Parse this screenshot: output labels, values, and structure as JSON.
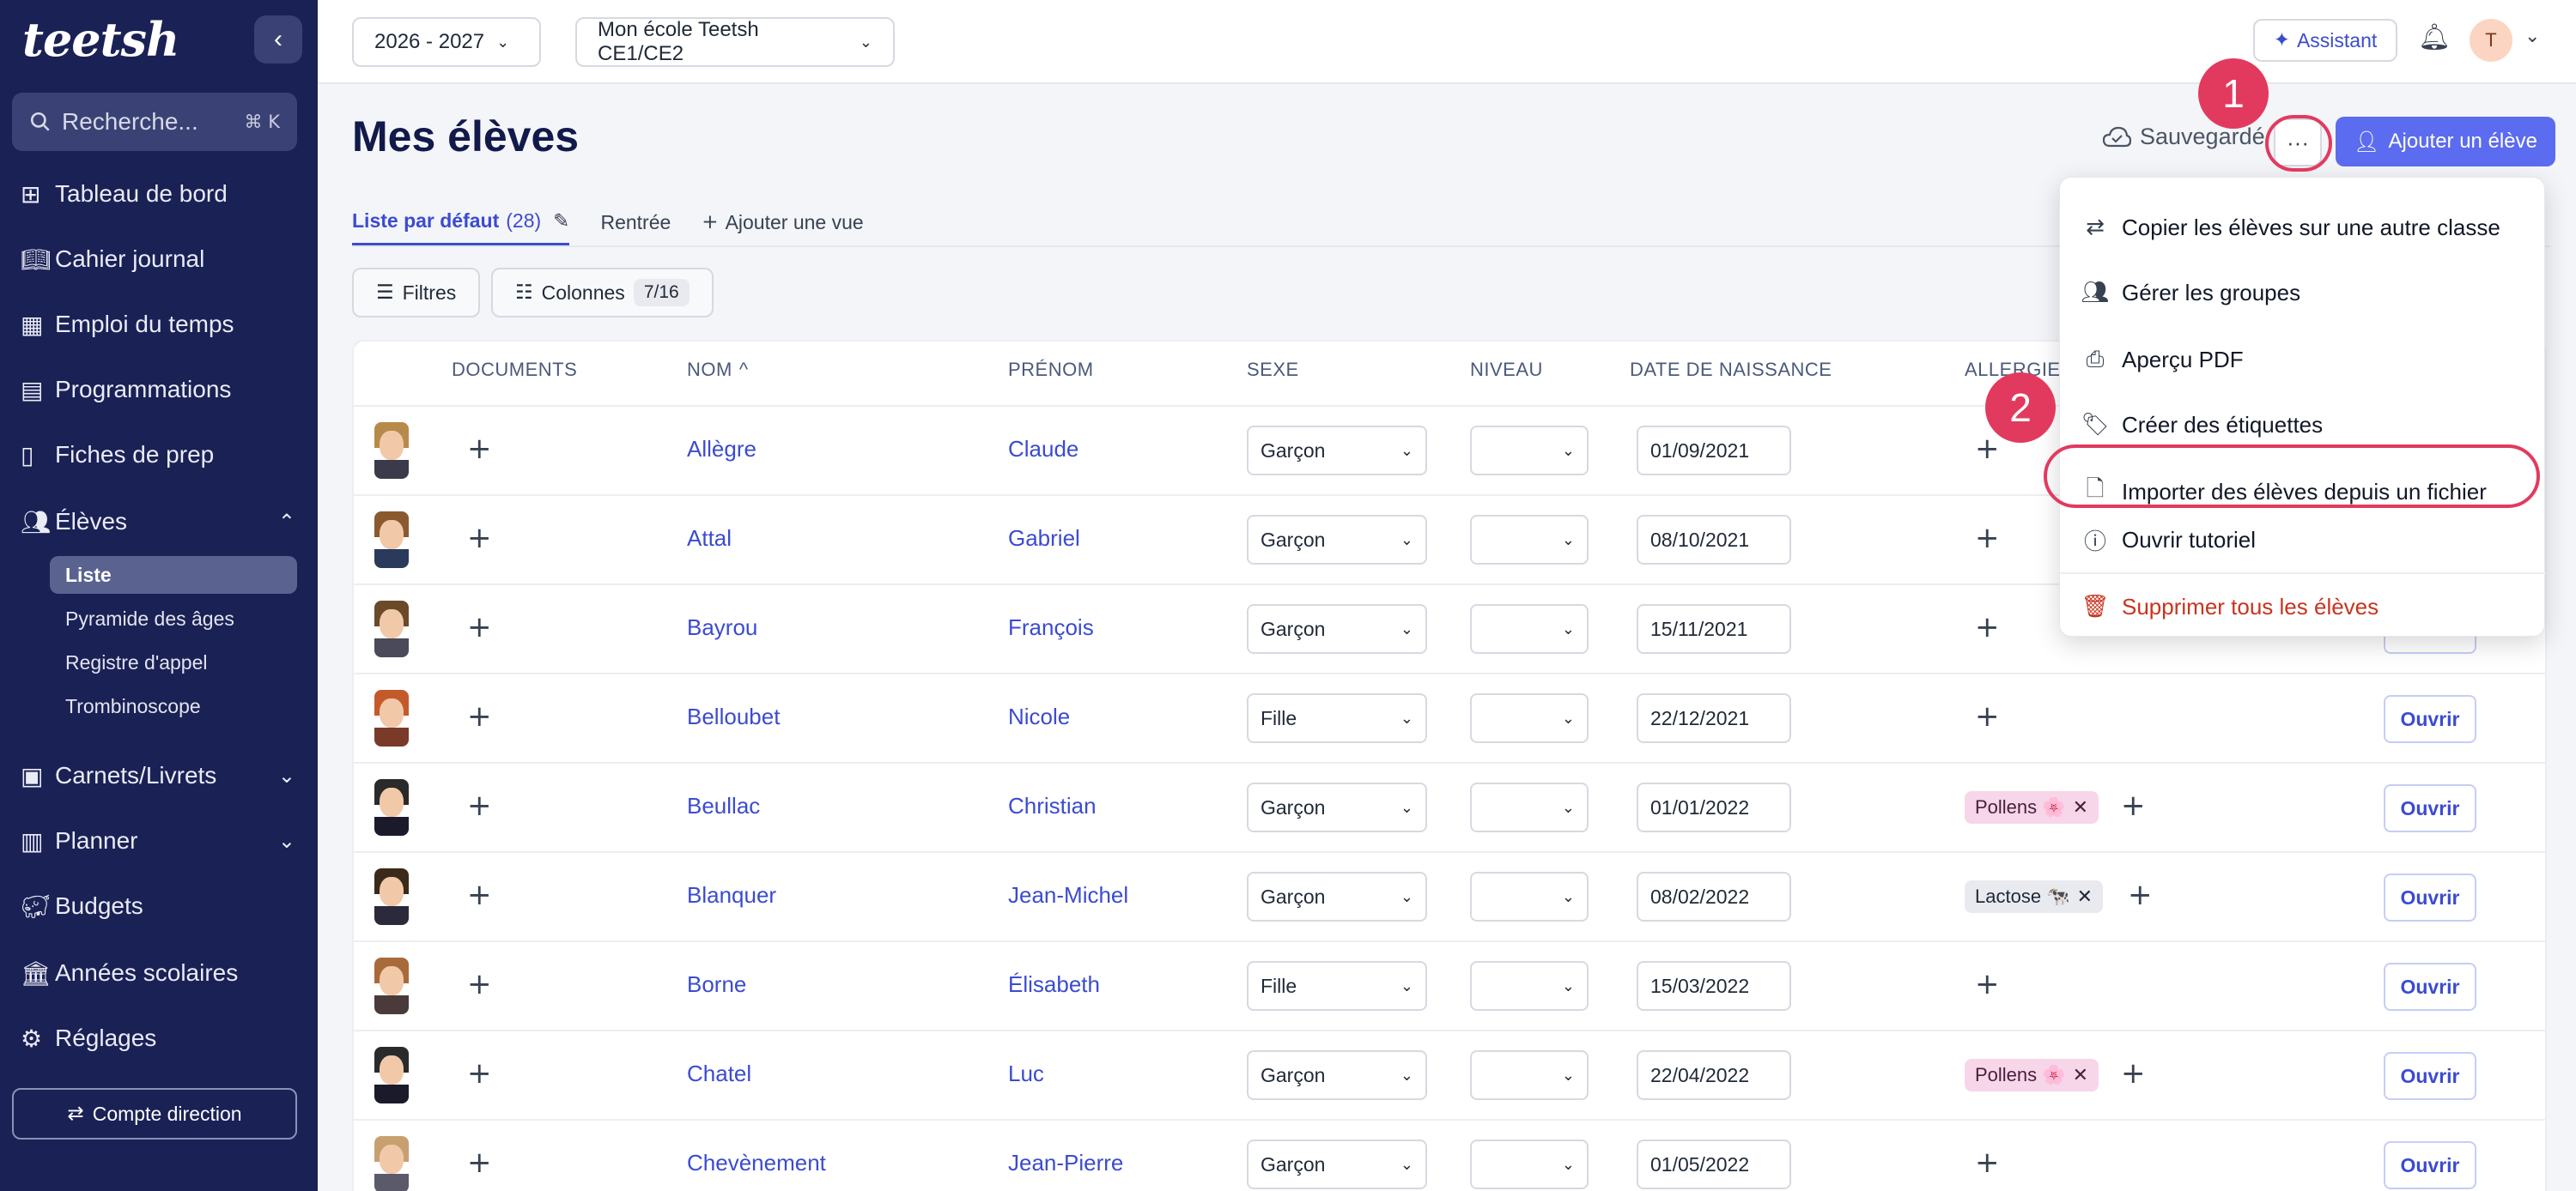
{
  "sidebar": {
    "logo": "teetsh",
    "search_placeholder": "Recherche...",
    "search_shortcut": "⌘ K",
    "items": [
      {
        "label": "Tableau de bord"
      },
      {
        "label": "Cahier journal"
      },
      {
        "label": "Emploi du temps"
      },
      {
        "label": "Programmations"
      },
      {
        "label": "Fiches de prep"
      },
      {
        "label": "Élèves"
      },
      {
        "label": "Carnets/Livrets"
      },
      {
        "label": "Planner"
      },
      {
        "label": "Budgets"
      },
      {
        "label": "Années scolaires"
      },
      {
        "label": "Réglages"
      }
    ],
    "sub_items": [
      {
        "label": "Liste"
      },
      {
        "label": "Pyramide des âges"
      },
      {
        "label": "Registre d'appel"
      },
      {
        "label": "Trombinoscope"
      }
    ],
    "account_button": "Compte direction"
  },
  "topbar": {
    "year": "2026 - 2027",
    "school": "Mon école Teetsh CE1/CE2",
    "assistant": "Assistant",
    "avatar_initial": "T"
  },
  "header": {
    "title": "Mes élèves",
    "saved": "Sauvegardé",
    "add_button": "Ajouter un élève"
  },
  "views": {
    "default_label": "Liste par défaut",
    "default_count": "(28)",
    "rentree": "Rentrée",
    "add_view": "Ajouter une vue"
  },
  "toolbar": {
    "filters": "Filtres",
    "columns": "Colonnes",
    "columns_count": "7/16"
  },
  "table": {
    "headers": [
      "DOCUMENTS",
      "NOM",
      "PRÉNOM",
      "SEXE",
      "NIVEAU",
      "DATE DE NAISSANCE",
      "ALLERGIES"
    ],
    "sort_indicator": "^",
    "open_label": "Ouvrir",
    "rows": [
      {
        "nom": "Allègre",
        "prenom": "Claude",
        "sexe": "Garçon",
        "date": "01/09/2021",
        "allergy": ""
      },
      {
        "nom": "Attal",
        "prenom": "Gabriel",
        "sexe": "Garçon",
        "date": "08/10/2021",
        "allergy": ""
      },
      {
        "nom": "Bayrou",
        "prenom": "François",
        "sexe": "Garçon",
        "date": "15/11/2021",
        "allergy": ""
      },
      {
        "nom": "Belloubet",
        "prenom": "Nicole",
        "sexe": "Fille",
        "date": "22/12/2021",
        "allergy": ""
      },
      {
        "nom": "Beullac",
        "prenom": "Christian",
        "sexe": "Garçon",
        "date": "01/01/2022",
        "allergy": "Pollens 🌸"
      },
      {
        "nom": "Blanquer",
        "prenom": "Jean-Michel",
        "sexe": "Garçon",
        "date": "08/02/2022",
        "allergy": "Lactose 🐄"
      },
      {
        "nom": "Borne",
        "prenom": "Élisabeth",
        "sexe": "Fille",
        "date": "15/03/2022",
        "allergy": ""
      },
      {
        "nom": "Chatel",
        "prenom": "Luc",
        "sexe": "Garçon",
        "date": "22/04/2022",
        "allergy": "Pollens 🌸"
      },
      {
        "nom": "Chevènement",
        "prenom": "Jean-Pierre",
        "sexe": "Garçon",
        "date": "01/05/2022",
        "allergy": ""
      }
    ]
  },
  "menu": {
    "items": [
      {
        "label": "Copier les élèves sur une autre classe"
      },
      {
        "label": "Gérer les groupes"
      },
      {
        "label": "Aperçu PDF"
      },
      {
        "label": "Créer des étiquettes"
      },
      {
        "label": "Importer des élèves depuis un fichier"
      },
      {
        "label": "Ouvrir tutoriel"
      },
      {
        "label": "Supprimer tous les élèves"
      }
    ]
  },
  "callouts": [
    "1",
    "2"
  ],
  "colors": {
    "sidebar": "#1a2155",
    "accent": "#5b6cf0",
    "link": "#3b4bd1",
    "callout": "#e23a5e",
    "danger": "#c8341f"
  }
}
